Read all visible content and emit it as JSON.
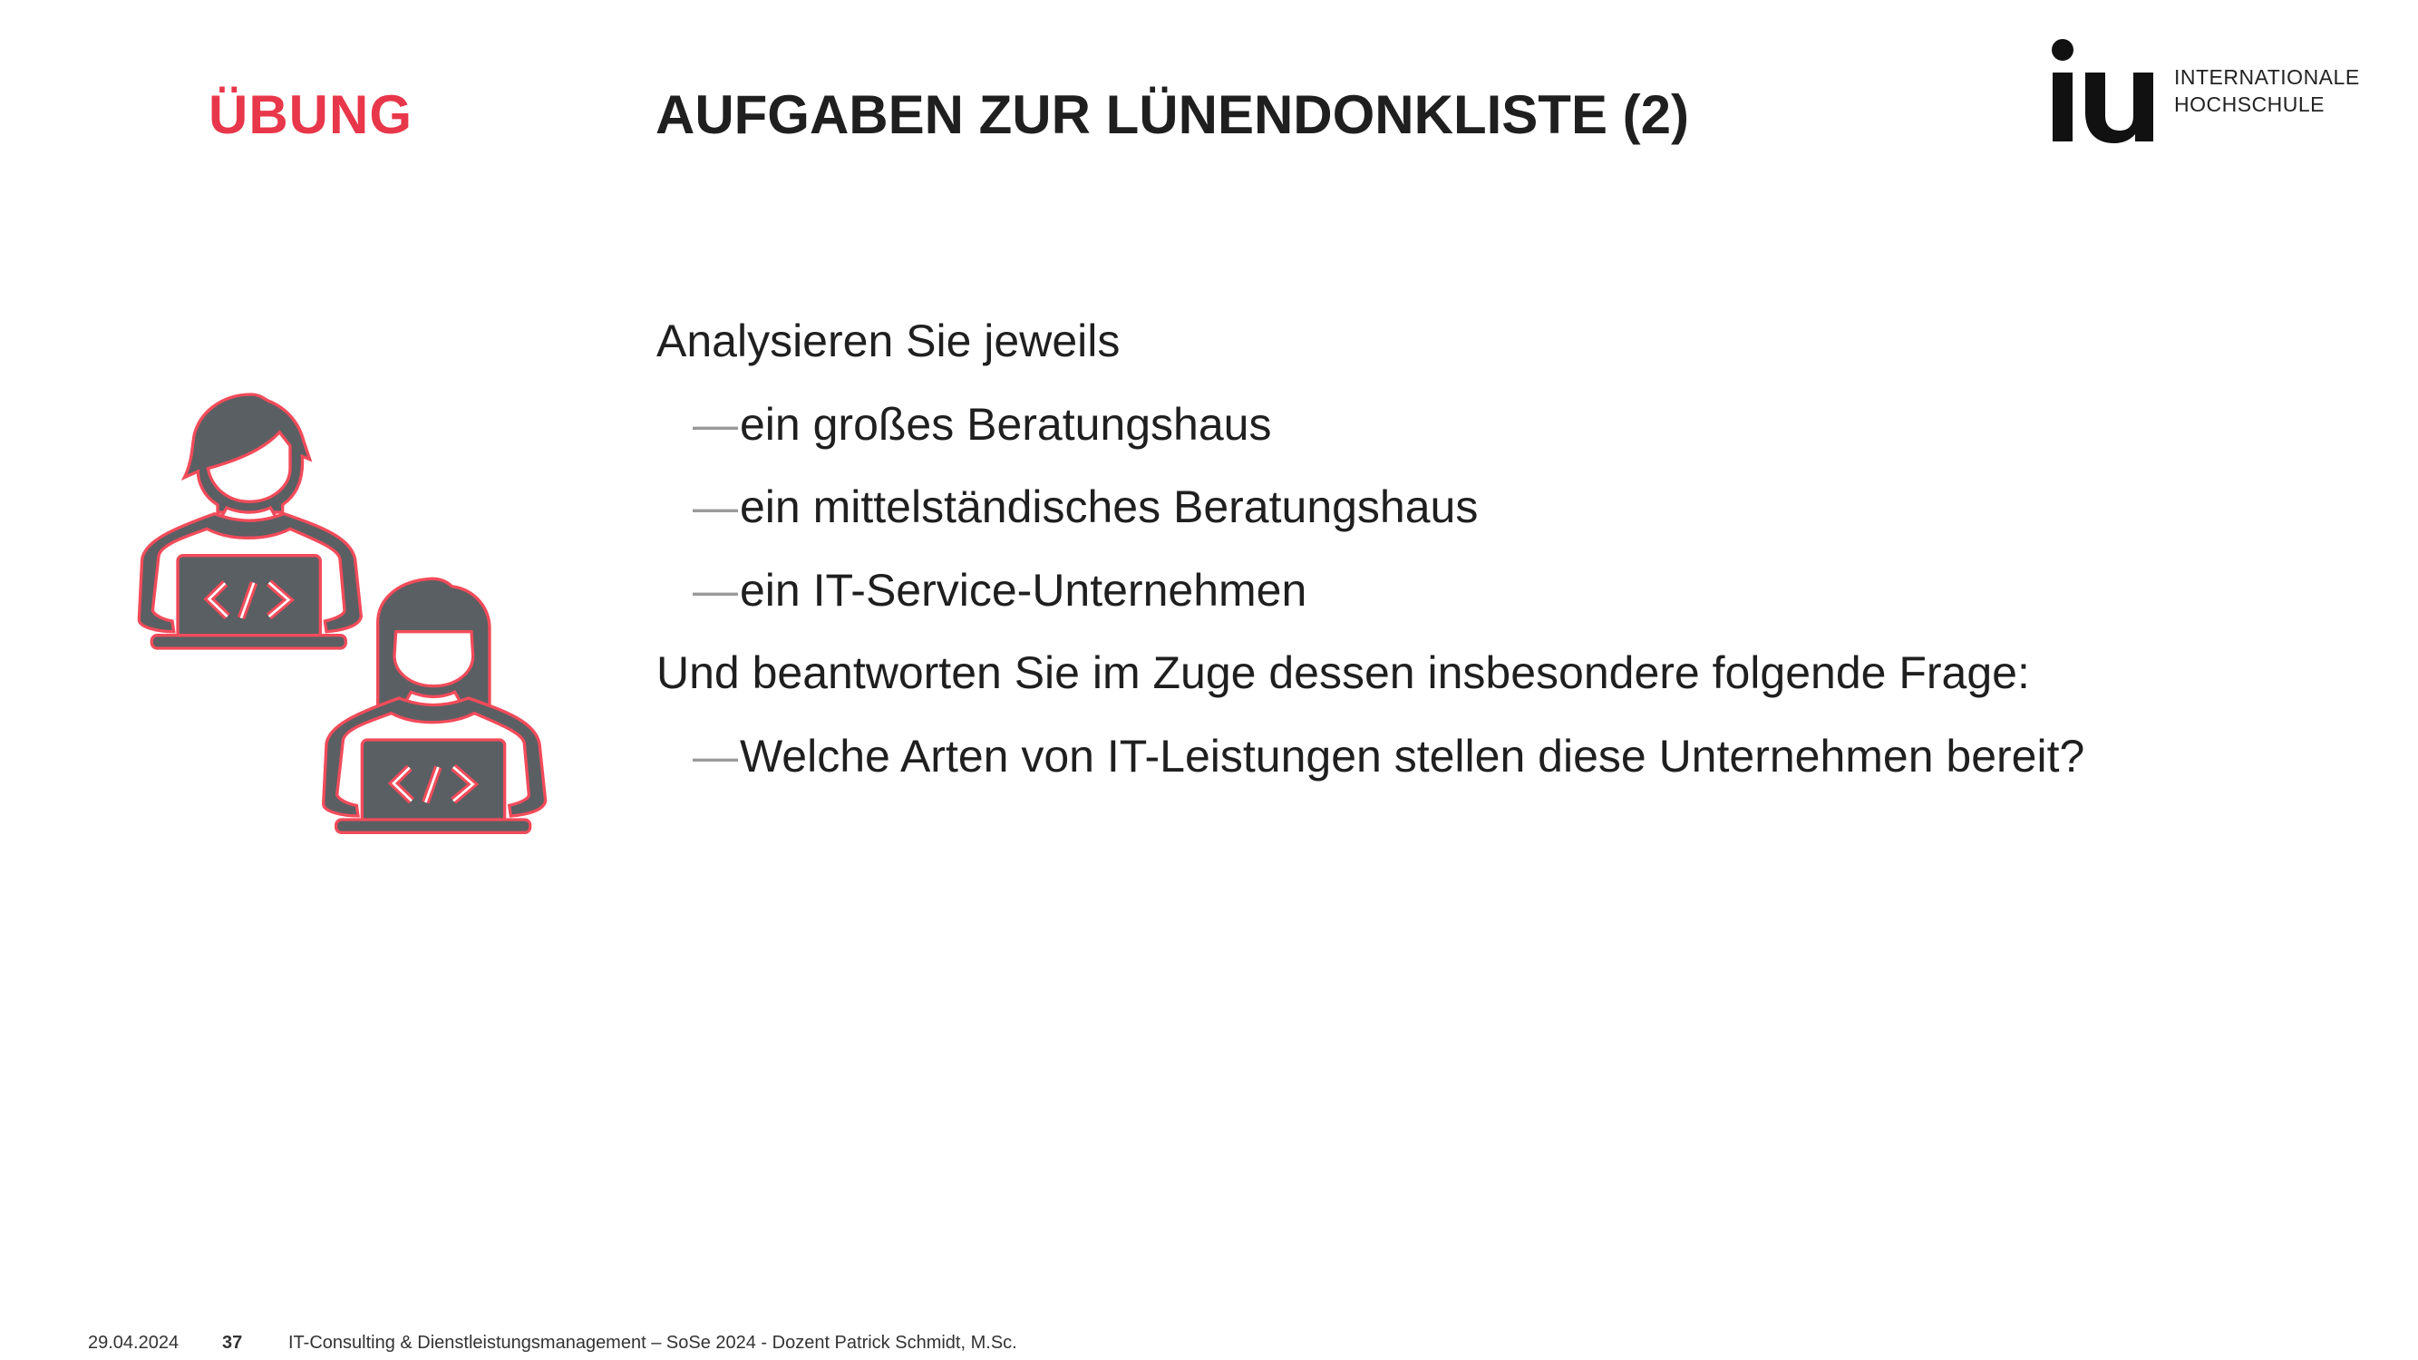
{
  "header": {
    "kicker": "ÜBUNG",
    "title": "AUFGABEN ZUR LÜNENDONKLISTE (2)",
    "logo": {
      "mark": "iu",
      "line1": "INTERNATIONALE",
      "line2": "HOCHSCHULE"
    }
  },
  "content": {
    "lines": [
      {
        "text": "Analysieren Sie jeweils",
        "level": 0
      },
      {
        "text": "ein großes Beratungshaus",
        "level": 1
      },
      {
        "text": "ein mittelständisches Beratungshaus",
        "level": 1
      },
      {
        "text": "ein IT-Service-Unternehmen",
        "level": 1
      },
      {
        "text": "Und beantworten Sie im Zuge dessen insbesondere folgende Frage:",
        "level": 0
      },
      {
        "text": "Welche Arten von IT-Leistungen stellen diese Unternehmen bereit?",
        "level": 1
      }
    ],
    "dash": "—"
  },
  "illustration": {
    "icon": "developers-with-laptops-icon",
    "fill": "#5a5f63",
    "stroke": "#f24b5a"
  },
  "footer": {
    "date": "29.04.2024",
    "page": "37",
    "course": "IT-Consulting & Dienstleistungsmanagement – SoSe 2024 - Dozent Patrick Schmidt, M.Sc."
  },
  "colors": {
    "accent": "#e8374a",
    "text": "#1f1f1f"
  }
}
